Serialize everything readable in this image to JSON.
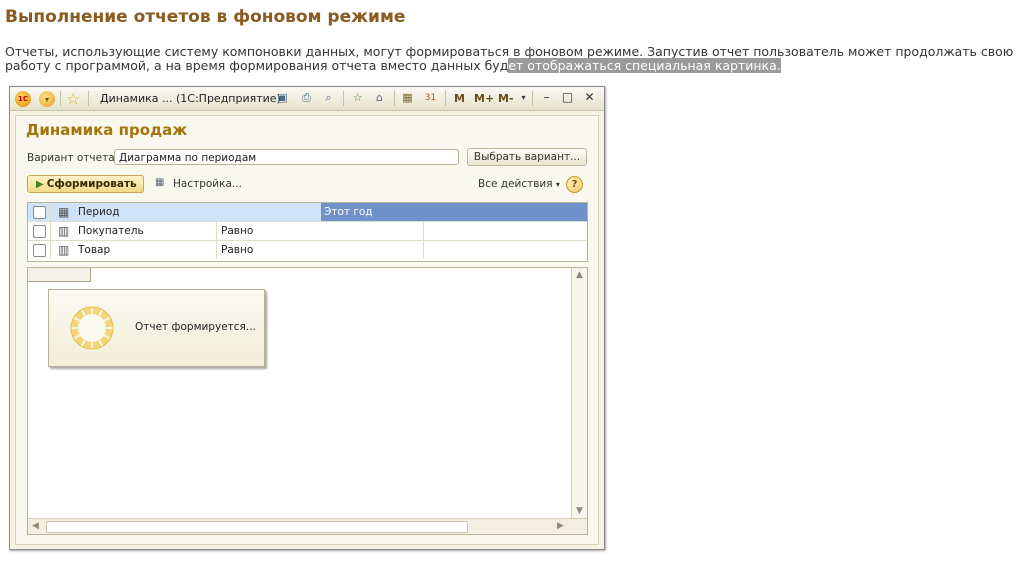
{
  "page": {
    "title": "Выполнение отчетов в фоновом режиме",
    "intro_line1": "Отчеты, использующие систему компоновки данных, могут формироваться в фоновом режиме. Запустив отчет пользователь может продолжать свою",
    "intro_line2_plain": "работу с программой, а на время формирования отчета вместо данных буд",
    "intro_line2_highlight": "ет отображаться специальная картинка."
  },
  "window": {
    "title": "Динамика ... (1С:Предприятие)",
    "logo_text": "1С",
    "m_buttons": [
      "M",
      "M+",
      "M-"
    ],
    "controls": {
      "minimize": "–",
      "maximize": "□",
      "close": "✕"
    }
  },
  "form": {
    "title": "Динамика продаж",
    "variant_label": "Вариант отчета:",
    "variant_value": "Диаграмма по периодам",
    "choose_variant_button": "Выбрать вариант...",
    "generate_button": "Сформировать",
    "settings_button": "Настройка...",
    "all_actions": "Все действия",
    "help": "?"
  },
  "settings_table": {
    "rows": [
      {
        "field": "Период",
        "condition": "",
        "value": "Этот год",
        "selected": true
      },
      {
        "field": "Покупатель",
        "condition": "Равно",
        "value": ""
      },
      {
        "field": "Товар",
        "condition": "Равно",
        "value": ""
      }
    ]
  },
  "report": {
    "status": "Отчет формируется..."
  },
  "colors": {
    "page_title": "#8a5a1e",
    "form_title": "#a3740c",
    "selected_value": "#6f93c8"
  }
}
